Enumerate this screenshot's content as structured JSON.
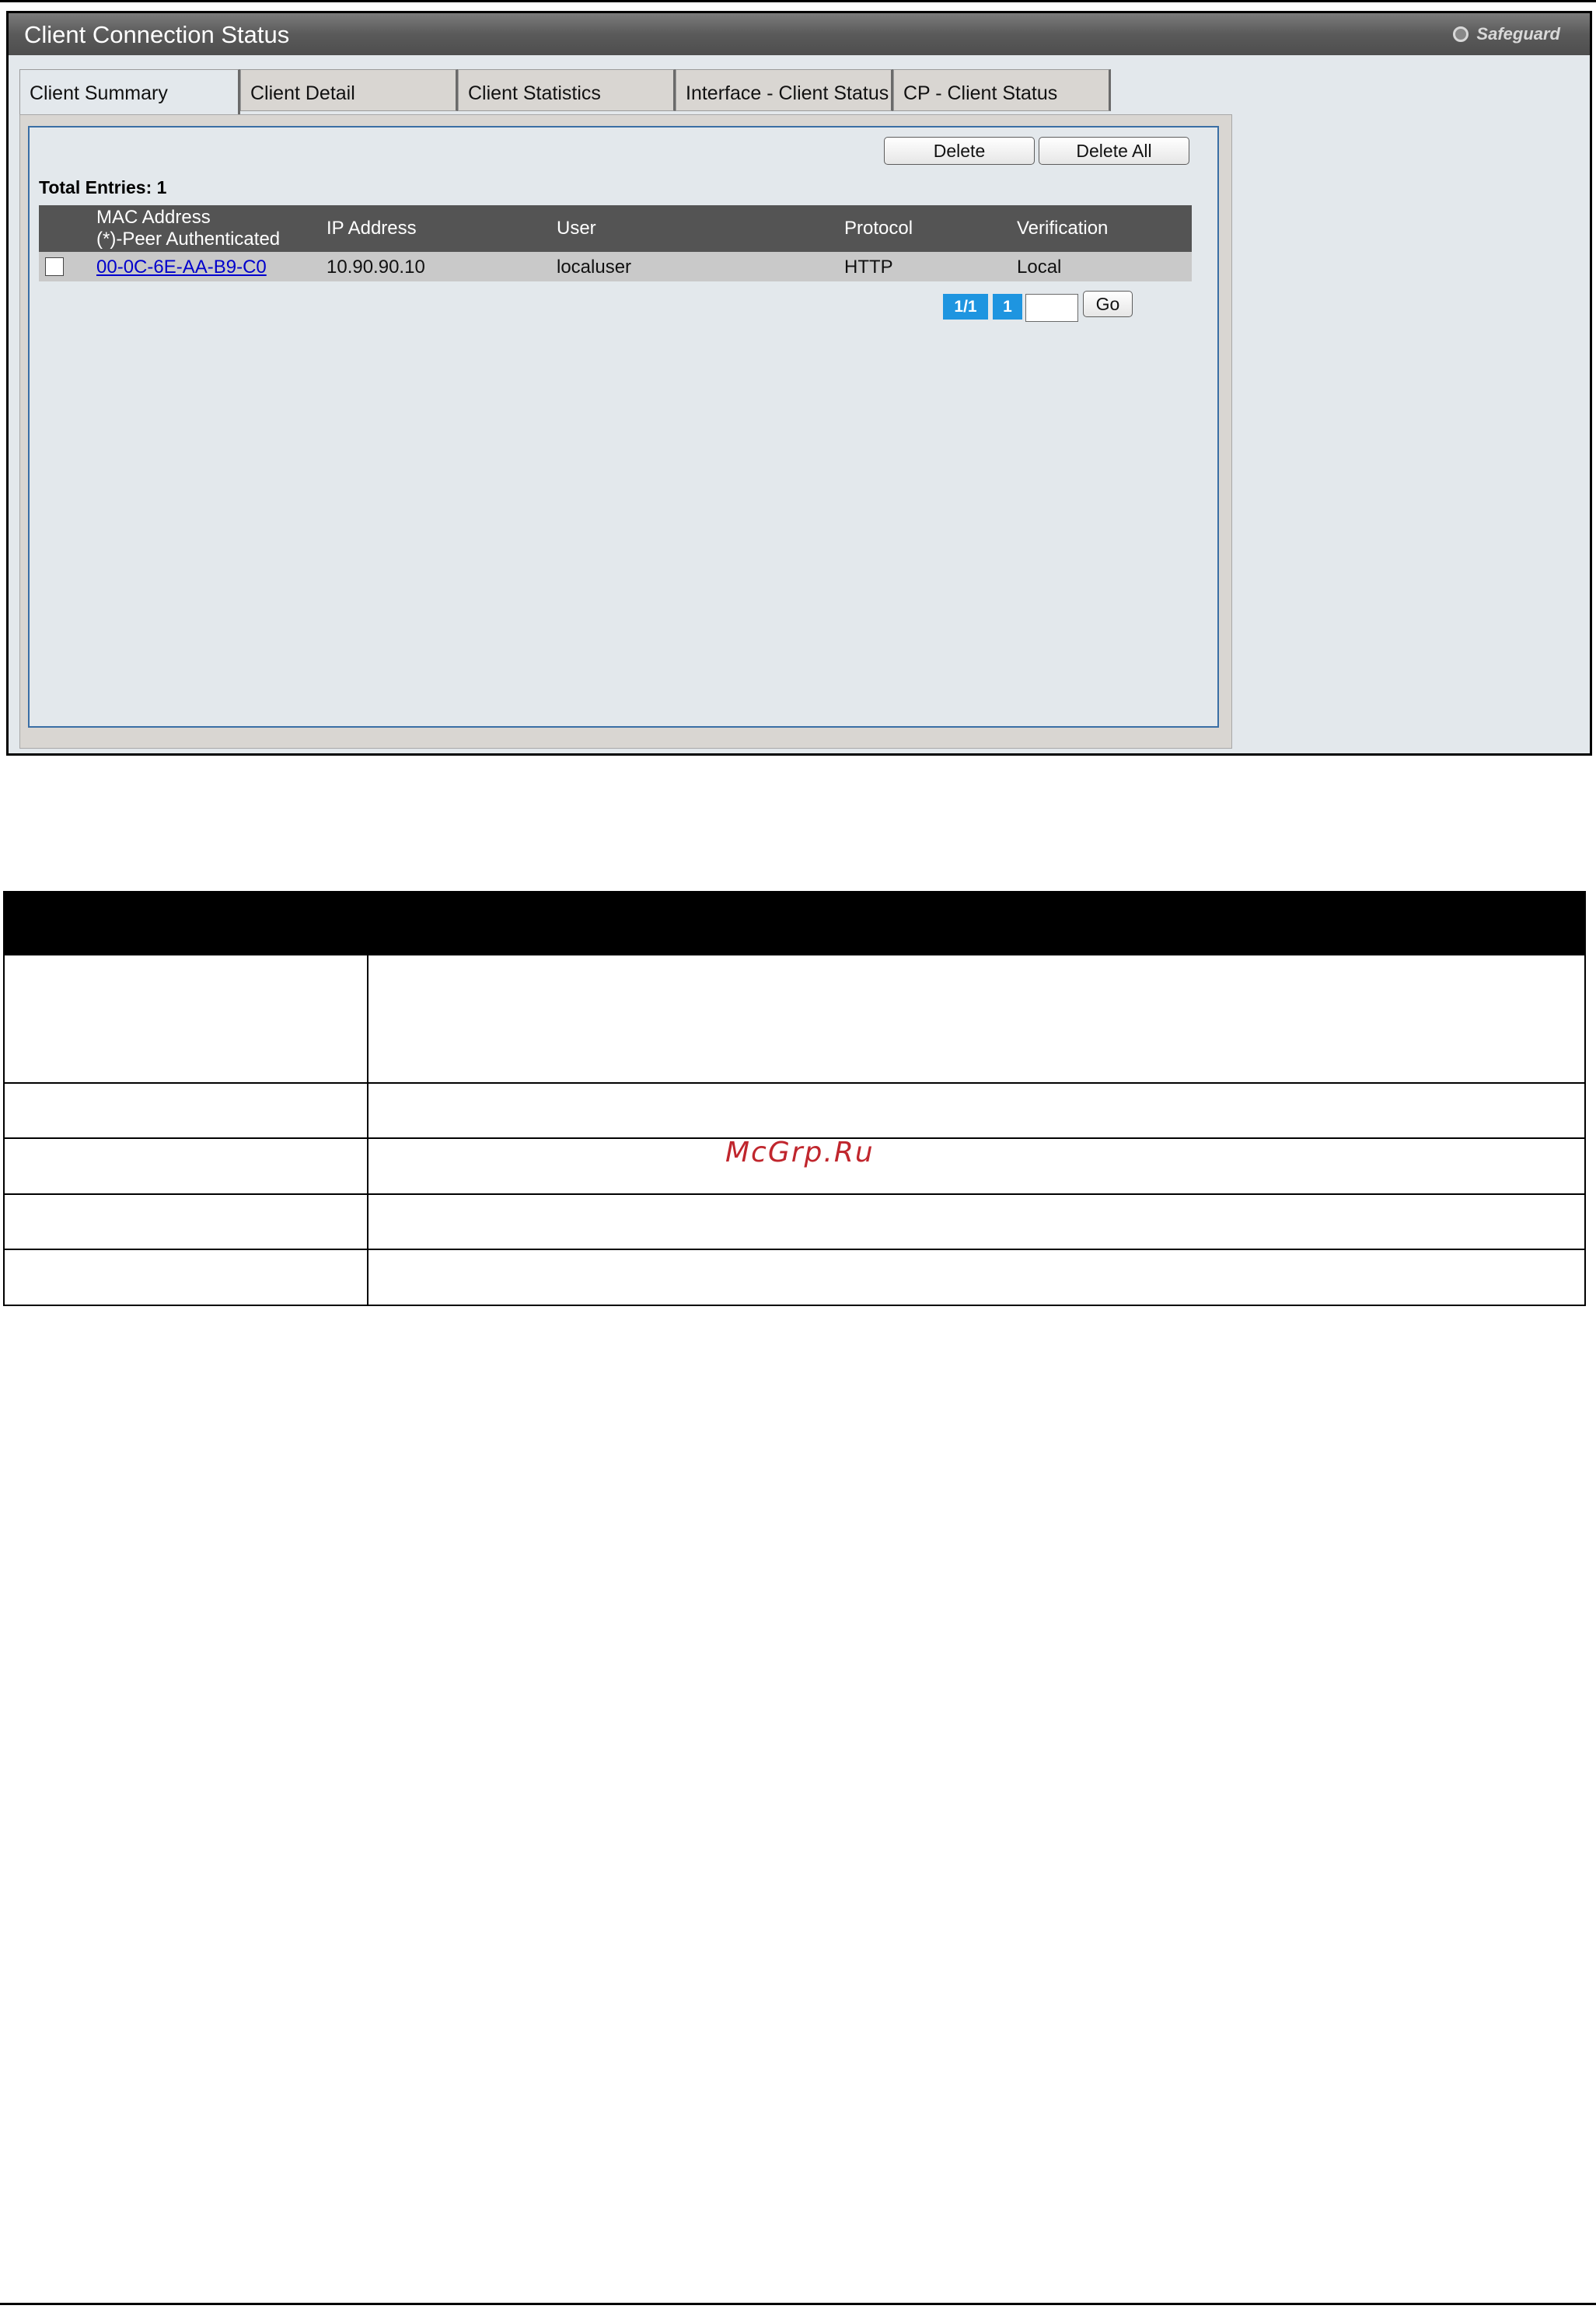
{
  "window": {
    "title": "Client Connection Status",
    "safeguard_label": "Safeguard"
  },
  "tabs": [
    {
      "label": "Client Summary",
      "active": true
    },
    {
      "label": "Client Detail",
      "active": false
    },
    {
      "label": "Client Statistics",
      "active": false
    },
    {
      "label": "Interface - Client Status",
      "active": false
    },
    {
      "label": "CP - Client Status",
      "active": false
    }
  ],
  "toolbar": {
    "delete_label": "Delete",
    "delete_all_label": "Delete All"
  },
  "summary": {
    "total_entries": "Total Entries: 1"
  },
  "table": {
    "columns": {
      "mac_line1": "MAC Address",
      "mac_line2": "(*)-Peer Authenticated",
      "ip": "IP Address",
      "user": "User",
      "protocol": "Protocol",
      "verification": "Verification"
    },
    "rows": [
      {
        "checked": false,
        "mac": "00-0C-6E-AA-B9-C0",
        "ip": "10.90.90.10",
        "user": "localuser",
        "protocol": "HTTP",
        "verification": "Local"
      }
    ]
  },
  "pagination": {
    "page_of": "1/1",
    "current_page": "1",
    "go_input_value": "",
    "go_label": "Go"
  },
  "description_table": {
    "rows": 5
  },
  "watermark": "McGrp.Ru",
  "colors": {
    "titlebar": "#5a5a5a",
    "panel_bg": "#e3e8ec",
    "table_header": "#545454",
    "row_bg": "#c9c9c9",
    "link": "#0000cc",
    "pager_blue": "#1e95e0",
    "watermark": "#c0262d"
  }
}
